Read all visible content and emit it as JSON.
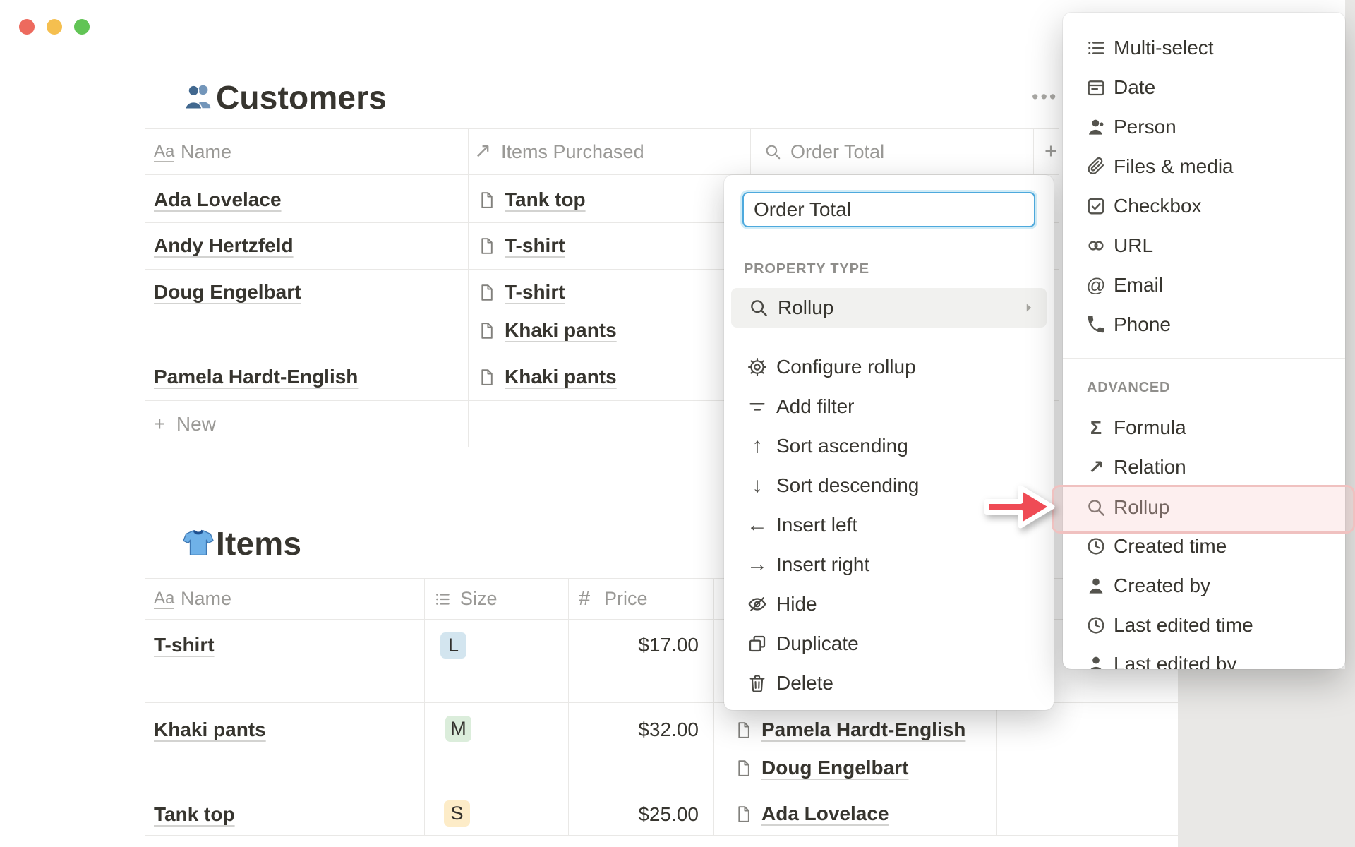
{
  "window": {
    "controls": [
      "close",
      "minimize",
      "zoom"
    ]
  },
  "customers_db": {
    "title": "Customers",
    "title_icon": "people-emoji",
    "options_glyph": "•••",
    "add_column_glyph": "+",
    "columns": [
      {
        "label": "Name",
        "icon": "text-type-icon",
        "glyph": "Aa"
      },
      {
        "label": "Items Purchased",
        "icon": "relation-icon",
        "glyph": "↗"
      },
      {
        "label": "Order Total",
        "icon": "rollup-icon"
      }
    ],
    "rows": [
      {
        "name": "Ada Lovelace",
        "items": [
          "Tank top"
        ]
      },
      {
        "name": "Andy Hertzfeld",
        "items": [
          "T-shirt"
        ]
      },
      {
        "name": "Doug Engelbart",
        "items": [
          "T-shirt",
          "Khaki pants"
        ]
      },
      {
        "name": "Pamela Hardt-English",
        "items": [
          "Khaki pants"
        ]
      }
    ],
    "new_row_plus": "+",
    "new_row_label": "New"
  },
  "items_db": {
    "title": "Items",
    "title_icon": "tshirt-emoji",
    "columns": [
      {
        "label": "Name",
        "icon": "text-type-icon",
        "glyph": "Aa"
      },
      {
        "label": "Size",
        "icon": "select-list-icon"
      },
      {
        "label": "Price",
        "icon": "number-icon",
        "glyph": "#"
      }
    ],
    "rows": [
      {
        "name": "T-shirt",
        "size": "L",
        "size_color": "#d3e5ef",
        "price": "$17.00",
        "purchased_by": []
      },
      {
        "name": "Khaki pants",
        "size": "M",
        "size_color": "#dbeddb",
        "price": "$32.00",
        "purchased_by": [
          "Pamela Hardt-English",
          "Doug Engelbart"
        ]
      },
      {
        "name": "Tank top",
        "size": "S",
        "size_color": "#fdecc8",
        "price": "$25.00",
        "purchased_by": [
          "Ada Lovelace"
        ]
      }
    ]
  },
  "property_menu": {
    "name_input": {
      "value": "Order Total"
    },
    "section_label": "PROPERTY TYPE",
    "selected_type": {
      "label": "Rollup",
      "icon": "rollup-icon"
    },
    "actions": [
      {
        "label": "Configure rollup",
        "icon": "gear-icon"
      },
      {
        "label": "Add filter",
        "icon": "filter-icon"
      },
      {
        "label": "Sort ascending",
        "icon": "arrow-up-icon",
        "glyph": "↑"
      },
      {
        "label": "Sort descending",
        "icon": "arrow-down-icon",
        "glyph": "↓"
      },
      {
        "label": "Insert left",
        "icon": "arrow-left-icon",
        "glyph": "←"
      },
      {
        "label": "Insert right",
        "icon": "arrow-right-icon",
        "glyph": "→"
      },
      {
        "label": "Hide",
        "icon": "eye-off-icon"
      },
      {
        "label": "Duplicate",
        "icon": "duplicate-icon"
      },
      {
        "label": "Delete",
        "icon": "trash-icon"
      }
    ]
  },
  "type_menu": {
    "basic": [
      {
        "label": "Multi-select",
        "icon": "multi-select-icon"
      },
      {
        "label": "Date",
        "icon": "calendar-icon"
      },
      {
        "label": "Person",
        "icon": "person-icon"
      },
      {
        "label": "Files & media",
        "icon": "paperclip-icon"
      },
      {
        "label": "Checkbox",
        "icon": "checkbox-icon"
      },
      {
        "label": "URL",
        "icon": "link-icon"
      },
      {
        "label": "Email",
        "icon": "at-icon",
        "glyph": "@"
      },
      {
        "label": "Phone",
        "icon": "phone-icon"
      }
    ],
    "advanced_label": "ADVANCED",
    "advanced": [
      {
        "label": "Formula",
        "icon": "sigma-icon",
        "glyph": "Σ"
      },
      {
        "label": "Relation",
        "icon": "relation-icon",
        "glyph": "↗"
      },
      {
        "label": "Rollup",
        "icon": "rollup-icon",
        "highlighted": true
      },
      {
        "label": "Created time",
        "icon": "clock-icon"
      },
      {
        "label": "Created by",
        "icon": "person-icon"
      },
      {
        "label": "Last edited time",
        "icon": "clock-icon"
      },
      {
        "label": "Last edited by",
        "icon": "person-icon"
      }
    ]
  },
  "annotation": {
    "arrow_color": "#ef4b55",
    "highlight_border": "#f0c1c0",
    "highlight_fill": "#f8e6e6"
  },
  "colors": {
    "text": "#37352f",
    "muted": "#9a9996",
    "grid_line": "#e9e8e6",
    "selected_row": "#f1f1ef",
    "focus_blue": "#4da9dd",
    "chip_blue": "#d3e5ef",
    "chip_green": "#dbeddb",
    "chip_yellow": "#fdecc8",
    "traffic_red": "#ed6a5e",
    "traffic_yellow": "#f5bf4f",
    "traffic_green": "#61c455"
  }
}
